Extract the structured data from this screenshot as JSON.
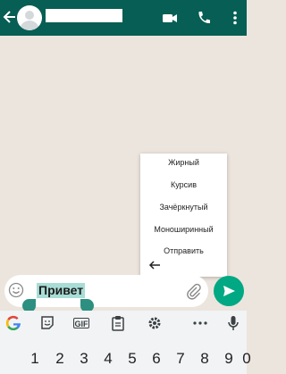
{
  "colors": {
    "header_bg": "#075e54",
    "chat_bg": "#ece5dd",
    "accent": "#00a884",
    "selection": "#a8ddd5",
    "keyboard_bg": "#f1f3f4"
  },
  "header": {
    "back_icon": "arrow-left",
    "icons": [
      "video-call-icon",
      "phone-icon",
      "more-vert-icon"
    ]
  },
  "format_menu": {
    "items": [
      "Жирный",
      "Курсив",
      "Зачёркнутый",
      "Моноширинный",
      "Отправить"
    ],
    "back_icon": "arrow-left"
  },
  "composer": {
    "text": "Привет",
    "emoji_icon": "smiley-icon",
    "attach_icon": "paperclip-icon",
    "send_icon": "send-icon"
  },
  "keyboard": {
    "toolbar": [
      "google-g-icon",
      "sticker-icon",
      "GIF",
      "clipboard-icon",
      "gear-icon",
      "more-horiz-icon",
      "mic-icon"
    ],
    "digits": [
      "1",
      "2",
      "3",
      "4",
      "5",
      "6",
      "7",
      "8",
      "9",
      "0"
    ]
  }
}
